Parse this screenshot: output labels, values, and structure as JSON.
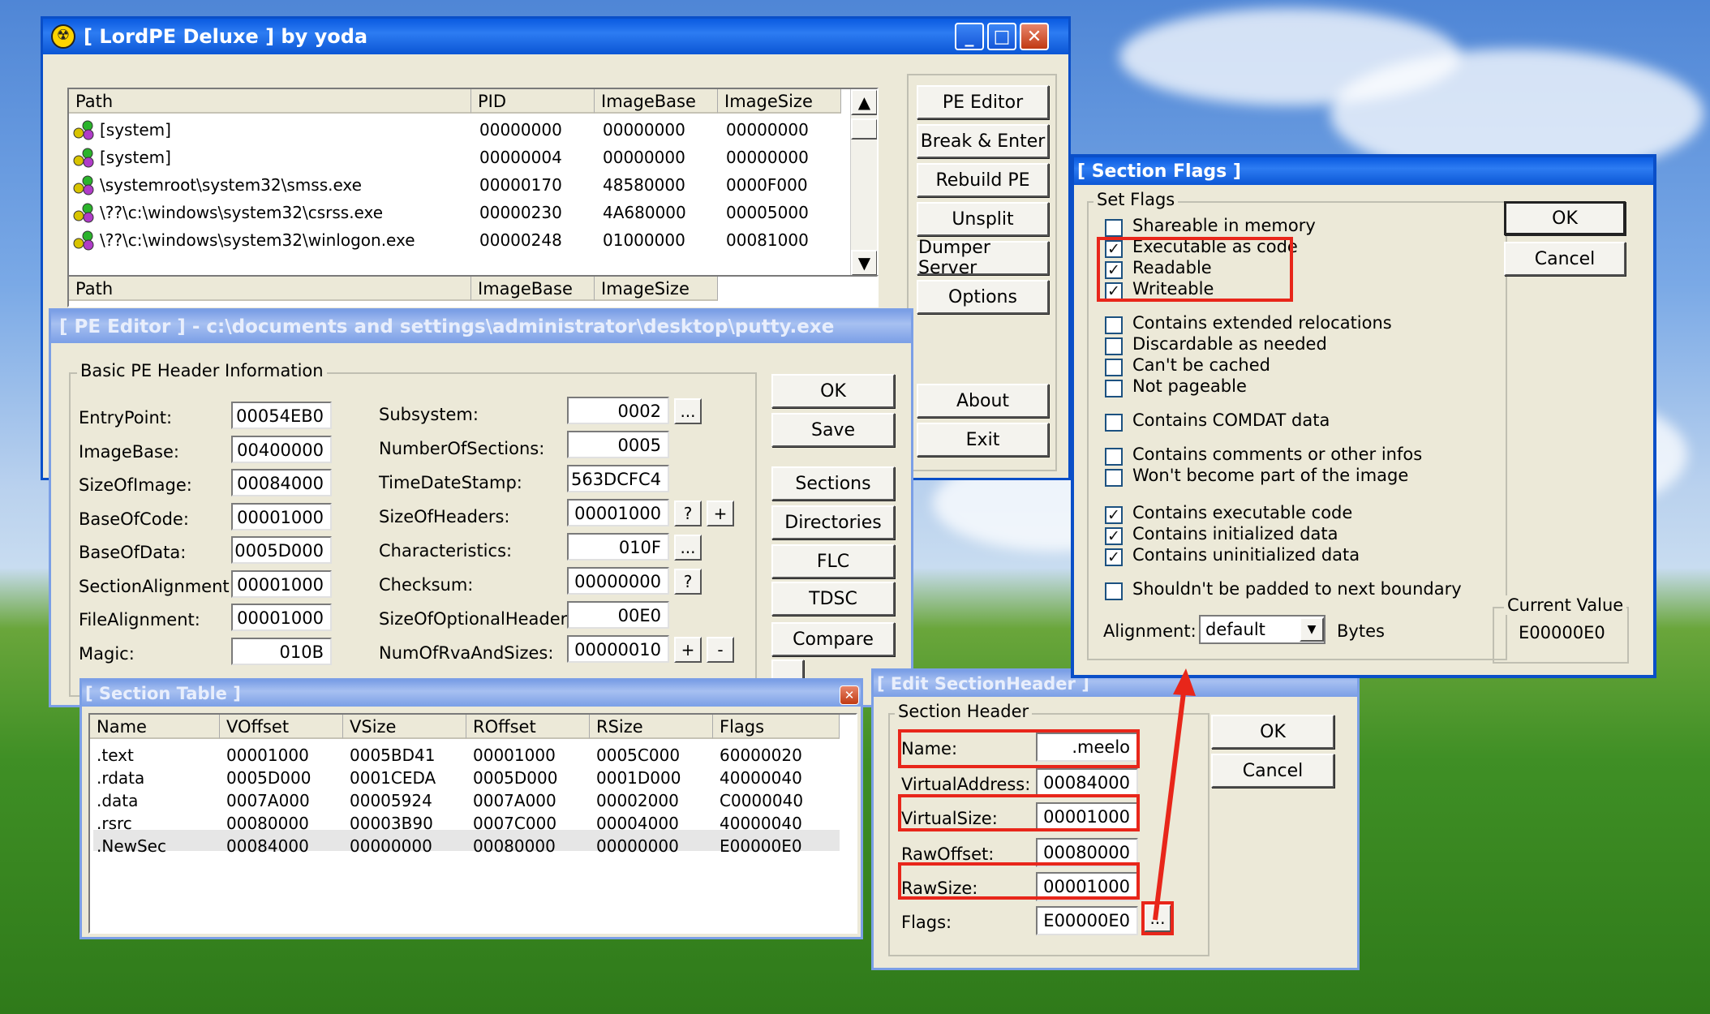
{
  "lordpe": {
    "title": "[ LordPE Deluxe ] by yoda",
    "columns": [
      "Path",
      "PID",
      "ImageBase",
      "ImageSize"
    ],
    "rows": [
      [
        "[system]",
        "00000000",
        "00000000",
        "00000000"
      ],
      [
        "[system]",
        "00000004",
        "00000000",
        "00000000"
      ],
      [
        "\\systemroot\\system32\\smss.exe",
        "00000170",
        "48580000",
        "0000F000"
      ],
      [
        "\\??\\c:\\windows\\system32\\csrss.exe",
        "00000230",
        "4A680000",
        "00005000"
      ],
      [
        "\\??\\c:\\windows\\system32\\winlogon.exe",
        "00000248",
        "01000000",
        "00081000"
      ]
    ],
    "module_columns": [
      "Path",
      "ImageBase",
      "ImageSize"
    ],
    "buttons": {
      "pe_editor": "PE Editor",
      "break_enter": "Break & Enter",
      "rebuild_pe": "Rebuild PE",
      "unsplit": "Unsplit",
      "dumper_server": "Dumper Server",
      "options": "Options",
      "about": "About",
      "exit": "Exit"
    }
  },
  "pe_editor": {
    "title": "[ PE Editor ] - c:\\documents and settings\\administrator\\desktop\\putty.exe",
    "group": "Basic PE Header Information",
    "left_fields": [
      {
        "label": "EntryPoint:",
        "value": "00054EB0"
      },
      {
        "label": "ImageBase:",
        "value": "00400000"
      },
      {
        "label": "SizeOfImage:",
        "value": "00084000"
      },
      {
        "label": "BaseOfCode:",
        "value": "00001000"
      },
      {
        "label": "BaseOfData:",
        "value": "0005D000"
      },
      {
        "label": "SectionAlignment:",
        "value": "00001000"
      },
      {
        "label": "FileAlignment:",
        "value": "00001000"
      },
      {
        "label": "Magic:",
        "value": "010B"
      }
    ],
    "right_fields": [
      {
        "label": "Subsystem:",
        "value": "0002"
      },
      {
        "label": "NumberOfSections:",
        "value": "0005"
      },
      {
        "label": "TimeDateStamp:",
        "value": "563DCFC4"
      },
      {
        "label": "SizeOfHeaders:",
        "value": "00001000"
      },
      {
        "label": "Characteristics:",
        "value": "010F"
      },
      {
        "label": "Checksum:",
        "value": "00000000"
      },
      {
        "label": "SizeOfOptionalHeader:",
        "value": "00E0"
      },
      {
        "label": "NumOfRvaAndSizes:",
        "value": "00000010"
      }
    ],
    "small_buttons": {
      "ellipsis": "...",
      "question": "?",
      "plus": "+",
      "minus": "-"
    },
    "buttons": {
      "ok": "OK",
      "save": "Save",
      "sections": "Sections",
      "directories": "Directories",
      "flc": "FLC",
      "tdsc": "TDSC",
      "compare": "Compare"
    }
  },
  "section_table": {
    "title": "[ Section Table ]",
    "columns": [
      "Name",
      "VOffset",
      "VSize",
      "ROffset",
      "RSize",
      "Flags"
    ],
    "rows": [
      [
        ".text",
        "00001000",
        "0005BD41",
        "00001000",
        "0005C000",
        "60000020"
      ],
      [
        ".rdata",
        "0005D000",
        "0001CEDA",
        "0005D000",
        "0001D000",
        "40000040"
      ],
      [
        ".data",
        "0007A000",
        "00005924",
        "0007A000",
        "00002000",
        "C0000040"
      ],
      [
        ".rsrc",
        "00080000",
        "00003B90",
        "0007C000",
        "00004000",
        "40000040"
      ],
      [
        ".NewSec",
        "00084000",
        "00000000",
        "00080000",
        "00000000",
        "E00000E0"
      ]
    ]
  },
  "edit_section": {
    "title": "[ Edit SectionHeader ]",
    "group": "Section Header",
    "fields": [
      {
        "label": "Name:",
        "value": ".meelo"
      },
      {
        "label": "VirtualAddress:",
        "value": "00084000"
      },
      {
        "label": "VirtualSize:",
        "value": "00001000"
      },
      {
        "label": "RawOffset:",
        "value": "00080000"
      },
      {
        "label": "RawSize:",
        "value": "00001000"
      },
      {
        "label": "Flags:",
        "value": "E00000E0"
      }
    ],
    "flags_button": "...",
    "ok": "OK",
    "cancel": "Cancel"
  },
  "section_flags": {
    "title": "[ Section Flags ]",
    "group": "Set Flags",
    "flags": [
      {
        "label": "Shareable in memory",
        "checked": false
      },
      {
        "label": "Executable as code",
        "checked": true
      },
      {
        "label": "Readable",
        "checked": true
      },
      {
        "label": "Writeable",
        "checked": true
      },
      {
        "label": "Contains extended relocations",
        "checked": false
      },
      {
        "label": "Discardable as needed",
        "checked": false
      },
      {
        "label": "Can't be cached",
        "checked": false
      },
      {
        "label": "Not pageable",
        "checked": false
      },
      {
        "label": "Contains COMDAT data",
        "checked": false
      },
      {
        "label": "Contains comments or other infos",
        "checked": false
      },
      {
        "label": "Won't become part of the image",
        "checked": false
      },
      {
        "label": "Contains executable code",
        "checked": true
      },
      {
        "label": "Contains initialized data",
        "checked": true
      },
      {
        "label": "Contains uninitialized data",
        "checked": true
      },
      {
        "label": "Shouldn't be padded to next boundary",
        "checked": false
      }
    ],
    "alignment_label": "Alignment:",
    "alignment_value": "default",
    "bytes_label": "Bytes",
    "current_value_label": "Current Value",
    "current_value": "E00000E0",
    "ok": "OK",
    "cancel": "Cancel"
  },
  "colors": {
    "highlight": "#e8261a",
    "titlebar": "#0a5ae0"
  }
}
